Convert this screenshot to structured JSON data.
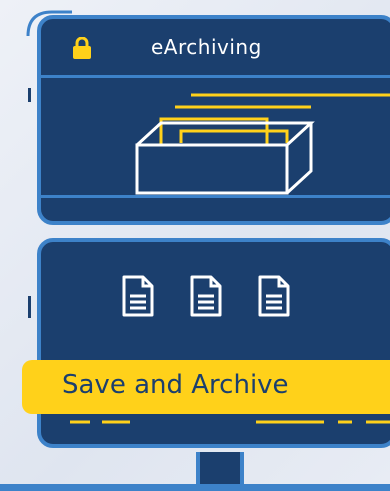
{
  "app": {
    "title": "eArchiving"
  },
  "actions": {
    "save_archive_label": "Save and Archive"
  },
  "icons": {
    "lock": "lock-icon",
    "box": "archive-box-icon",
    "document": "document-icon"
  },
  "colors": {
    "navy": "#1b3f6e",
    "blue": "#3d82c9",
    "yellow": "#ffd11a",
    "white": "#ffffff"
  }
}
